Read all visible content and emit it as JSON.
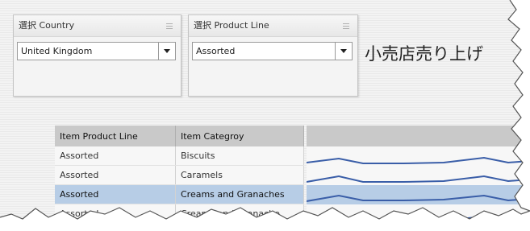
{
  "filters": [
    {
      "header": "選択 Country",
      "value": "United Kingdom"
    },
    {
      "header": "選択 Product Line",
      "value": "Assorted"
    }
  ],
  "title": "小売店売り上げ",
  "table": {
    "headers": [
      "Item Product Line",
      "Item Categroy"
    ],
    "rows": [
      [
        "Assorted",
        "Biscuits"
      ],
      [
        "Assorted",
        "Caramels"
      ],
      [
        "Assorted",
        "Creams and Granaches"
      ],
      [
        "Assorted",
        "Creams and Granache"
      ]
    ],
    "selected_row": 2
  },
  "colors": {
    "line": "#3a5ea8",
    "selected": "#b7cde6",
    "header": "#c9c9c9"
  }
}
